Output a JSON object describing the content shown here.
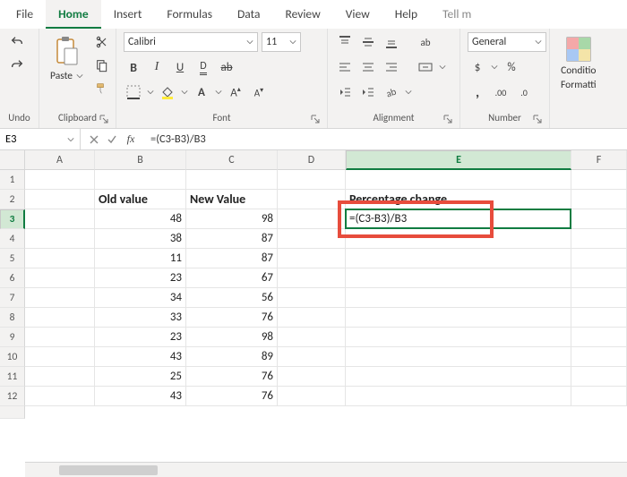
{
  "tabs": {
    "file": "File",
    "home": "Home",
    "insert": "Insert",
    "formulas": "Formulas",
    "data": "Data",
    "review": "Review",
    "view": "View",
    "help": "Help",
    "tellme": "Tell m"
  },
  "ribbon": {
    "undo_group": "Undo",
    "clipboard": {
      "label": "Clipboard",
      "paste": "Paste"
    },
    "font": {
      "label": "Font",
      "name": "Calibri",
      "size": "11"
    },
    "alignment": {
      "label": "Alignment",
      "wrap": "ab"
    },
    "number": {
      "label": "Number",
      "format": "General"
    },
    "styles": {
      "cond": "Conditio",
      "cond2": "Formatti"
    }
  },
  "formula_bar": {
    "name_box": "E3",
    "formula": "=(C3-B3)/B3"
  },
  "grid": {
    "columns": [
      "A",
      "B",
      "C",
      "D",
      "E",
      "F"
    ],
    "col_widths": [
      "wA",
      "wB",
      "wC",
      "wD",
      "wE",
      "wF"
    ],
    "active_col": "E",
    "active_row": 3,
    "headers": {
      "b": "Old value",
      "c": "New Value",
      "e": "Percentage change"
    },
    "rows": [
      {
        "n": 1,
        "b": "",
        "c": "",
        "e": ""
      },
      {
        "n": 2,
        "b": "hdr",
        "c": "hdr",
        "e": "hdr"
      },
      {
        "n": 3,
        "b": "48",
        "c": "98",
        "e": "=(C3-B3)/B3"
      },
      {
        "n": 4,
        "b": "38",
        "c": "87",
        "e": ""
      },
      {
        "n": 5,
        "b": "11",
        "c": "87",
        "e": ""
      },
      {
        "n": 6,
        "b": "23",
        "c": "67",
        "e": ""
      },
      {
        "n": 7,
        "b": "34",
        "c": "56",
        "e": ""
      },
      {
        "n": 8,
        "b": "33",
        "c": "76",
        "e": ""
      },
      {
        "n": 9,
        "b": "23",
        "c": "98",
        "e": ""
      },
      {
        "n": 10,
        "b": "43",
        "c": "89",
        "e": ""
      },
      {
        "n": 11,
        "b": "25",
        "c": "76",
        "e": ""
      },
      {
        "n": 12,
        "b": "43",
        "c": "76",
        "e": ""
      }
    ]
  }
}
